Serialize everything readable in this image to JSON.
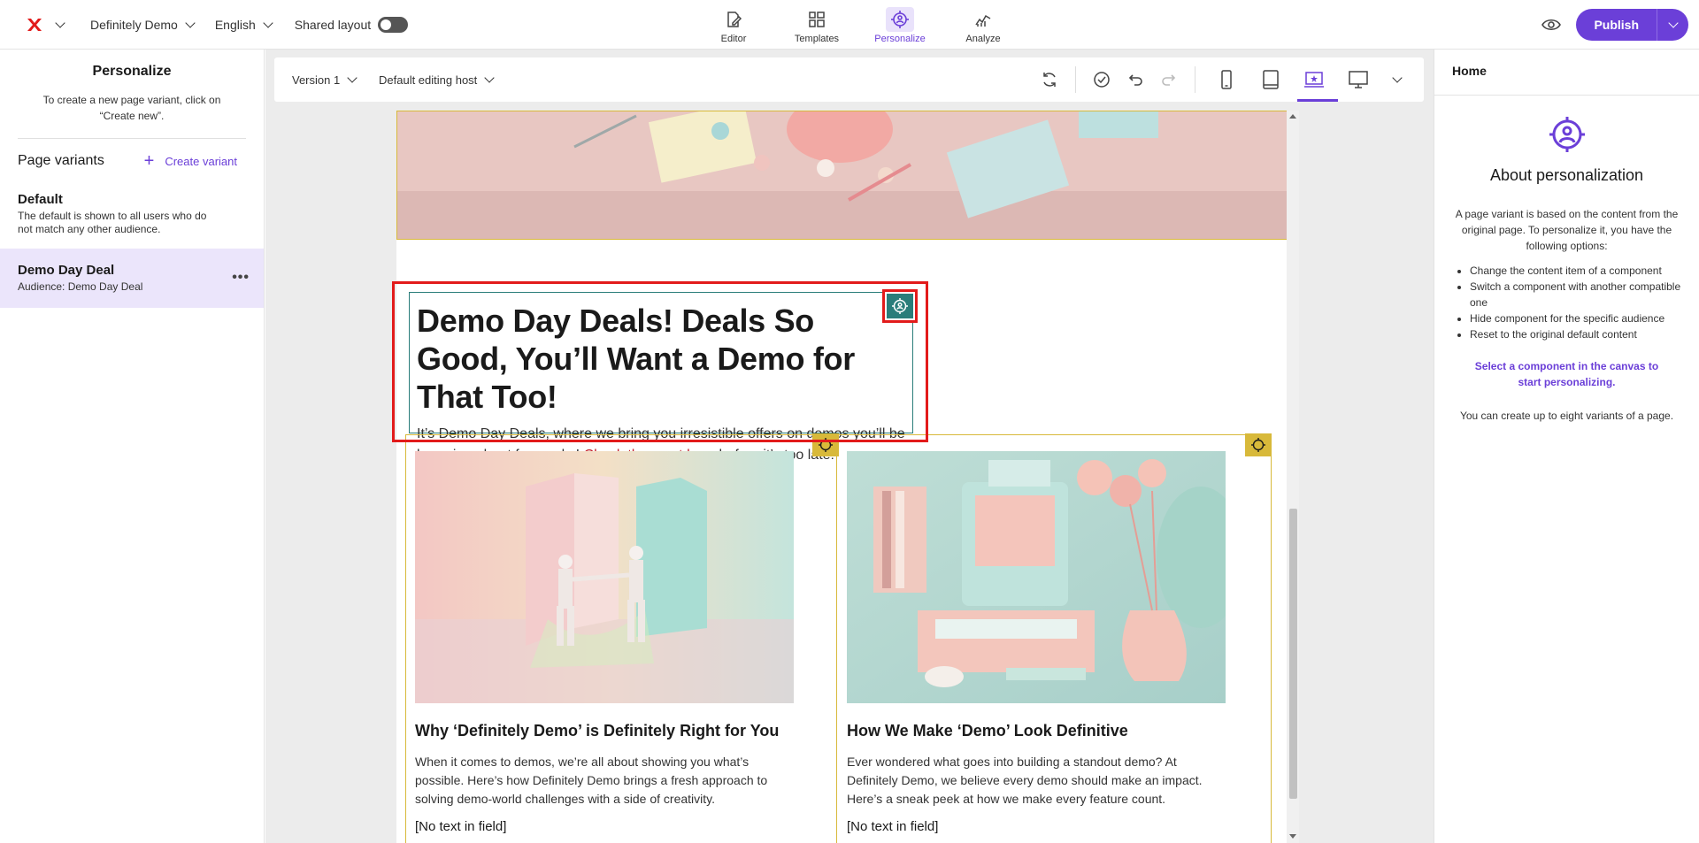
{
  "topbar": {
    "site_name": "Definitely Demo",
    "language": "English",
    "shared_layout_label": "Shared layout",
    "shared_layout_on": false,
    "tabs": [
      {
        "label": "Editor",
        "icon": "editor-icon",
        "active": false
      },
      {
        "label": "Templates",
        "icon": "templates-icon",
        "active": false
      },
      {
        "label": "Personalize",
        "icon": "personalize-icon",
        "active": true
      },
      {
        "label": "Analyze",
        "icon": "analyze-icon",
        "active": false
      }
    ],
    "publish_label": "Publish",
    "accent_color": "#6b3fd8"
  },
  "left_panel": {
    "title": "Personalize",
    "description": "To create a new page variant, click on “Create new”.",
    "variants_heading": "Page variants",
    "create_variant_label": "Create variant",
    "variants": [
      {
        "name": "Default",
        "description": "The default is shown to all users who do not match any other audience.",
        "selected": false
      },
      {
        "name": "Demo Day Deal",
        "description": "Audience: Demo Day Deal",
        "selected": true
      }
    ]
  },
  "canvas_toolbar": {
    "version": "Version 1",
    "editing_host": "Default editing host"
  },
  "page": {
    "heading": "Demo Day Deals! Deals So Good, You’ll Want a Demo for That Too!",
    "body_before_link": "It’s Demo Day Deals, where we bring you irresistible offers on demos you’ll be bragging about for weeks! ",
    "link_text": "Check them out here",
    "body_after_link": " before it’s too late!",
    "cards": [
      {
        "title": "Why ‘Definitely Demo’ is Definitely Right for You",
        "text": "When it comes to demos, we’re all about showing you what’s possible. Here’s how Definitely Demo brings a fresh approach to solving demo-world challenges with a side of creativity.",
        "extra": "[No text in field]"
      },
      {
        "title": "How We Make ‘Demo’ Look Definitive",
        "text": "Ever wondered what goes into building a standout demo? At Definitely Demo, we believe every demo should make an impact. Here’s a sneak peek at how we make every feature count.",
        "extra": "[No text in field]"
      }
    ]
  },
  "right_panel": {
    "breadcrumb": "Home",
    "title": "About personalization",
    "description": "A page variant is based on the content from the original page. To personalize it, you have the following options:",
    "options": [
      "Change the content item of a component",
      "Switch a component with another compatible one",
      "Hide component for the specific audience",
      "Reset to the original default content"
    ],
    "cta": "Select a component in the canvas to start personalizing.",
    "limit_note": "You can create up to eight variants of a page."
  }
}
